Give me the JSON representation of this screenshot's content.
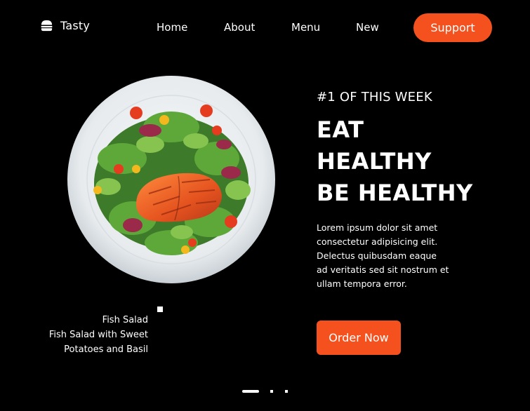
{
  "brand": {
    "name": "Tasty",
    "icon": "burger-icon"
  },
  "nav": {
    "home": "Home",
    "about": "About",
    "menu": "Menu",
    "new": "New",
    "support": "Support"
  },
  "hero": {
    "kicker": "#1 OF THIS WEEK",
    "headline": [
      "EAT",
      "HEALTHY",
      "BE HEALTHY"
    ],
    "description": "Lorem ipsum dolor sit amet consectetur adipisicing elit. Delectus quibusdam eaque ad veritatis sed sit nostrum et ullam tempora error.",
    "cta": "Order Now",
    "dish_image": "fish-salad-plate"
  },
  "caption": {
    "title": "Fish Salad",
    "subtitle": "Fish Salad with Sweet Potatoes and Basil"
  },
  "slider": {
    "count": 3,
    "active": 1
  },
  "colors": {
    "background": "#000000",
    "accent": "#f5511f",
    "text": "#ffffff"
  }
}
